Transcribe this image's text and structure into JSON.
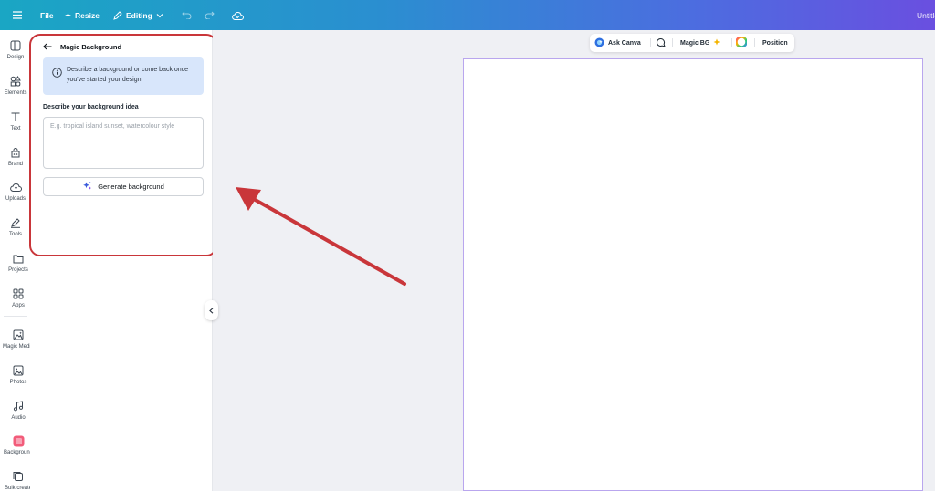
{
  "topbar": {
    "menu_icon": "hamburger-icon",
    "file_label": "File",
    "resize_label": "Resize",
    "editing_label": "Editing",
    "design_title": "Untitled"
  },
  "rail": {
    "items": [
      {
        "label": "Design",
        "icon": "layout-icon"
      },
      {
        "label": "Elements",
        "icon": "shapes-icon"
      },
      {
        "label": "Text",
        "icon": "text-icon"
      },
      {
        "label": "Brand",
        "icon": "brand-icon"
      },
      {
        "label": "Uploads",
        "icon": "cloud-upload-icon"
      },
      {
        "label": "Tools",
        "icon": "pen-icon"
      },
      {
        "label": "Projects",
        "icon": "folder-icon"
      },
      {
        "label": "Apps",
        "icon": "apps-grid-icon"
      },
      {
        "label": "Magic Media",
        "icon": "magic-media-icon"
      },
      {
        "label": "Photos",
        "icon": "photo-icon"
      },
      {
        "label": "Audio",
        "icon": "music-icon"
      },
      {
        "label": "Background",
        "icon": "background-icon"
      },
      {
        "label": "Bulk create",
        "icon": "bulk-create-icon"
      }
    ]
  },
  "panel": {
    "title": "Magic Background",
    "info_text": "Describe a background or come back once you've started your design.",
    "field_label": "Describe your background idea",
    "field_placeholder": "E.g. tropical island sunset, watercolour style",
    "generate_label": "Generate background"
  },
  "context_bar": {
    "ask_label": "Ask Canva",
    "magic_bg_label": "Magic BG",
    "position_label": "Position"
  },
  "colors": {
    "highlight": "#c9363a",
    "arrow": "#c9363a",
    "page_border": "#b9a6ee"
  }
}
